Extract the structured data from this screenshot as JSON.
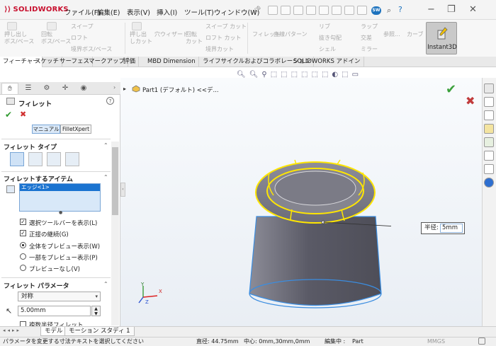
{
  "app": {
    "logo": "SOLIDWORKS"
  },
  "menu": [
    "ファイル(F)",
    "編集(E)",
    "表示(V)",
    "挿入(I)",
    "ツール(T)",
    "ウィンドウ(W)"
  ],
  "badge": {
    "label": "SW"
  },
  "ribbon": {
    "features_group": [
      {
        "label": "押し出し\nボス/ベース"
      },
      {
        "label": "回転\nボス/ベース"
      },
      {
        "label": "スイープ"
      },
      {
        "label": "ロフト"
      },
      {
        "label": "境界ボス/ベース"
      }
    ],
    "cut_group": [
      {
        "label": "押し出\nしカット"
      },
      {
        "label": "穴ウィザード"
      },
      {
        "label": "回転\nカット"
      },
      {
        "label": "スイープ カット"
      },
      {
        "label": "ロフト カット"
      },
      {
        "label": "境界カット"
      }
    ],
    "tools_group": [
      {
        "label": "フィレット"
      },
      {
        "label": "直線パターン"
      },
      {
        "label": "リブ"
      },
      {
        "label": "抜き勾配"
      },
      {
        "label": "シェル"
      },
      {
        "label": "ラップ"
      },
      {
        "label": "交差"
      },
      {
        "label": "ミラー"
      },
      {
        "label": "参照..."
      },
      {
        "label": "カーブ"
      }
    ],
    "instant3d_label": "Instant3D"
  },
  "command_tabs": [
    {
      "label": "フィーチャー",
      "active": true
    },
    {
      "label": "スケッチ"
    },
    {
      "label": "サーフェス"
    },
    {
      "label": "マークアップ"
    },
    {
      "label": "評価"
    },
    {
      "label": "MBD Dimension"
    },
    {
      "label": "ライフサイクルおよびコラボレーション"
    },
    {
      "label": "SOLIDWORKS アドイン"
    }
  ],
  "tree": {
    "breadcrumb": "Part1 (デフォルト) <<デ..."
  },
  "panel": {
    "title": "フィレット",
    "mode_buttons": [
      "マニュアル",
      "FilletXpert"
    ],
    "fillet_type_title": "フィレット タイプ",
    "items_title": "フィレットするアイテム",
    "edge_item": "エッジ<1>",
    "options": [
      {
        "label": "選択ツールバーを表示(L)",
        "checked": true
      },
      {
        "label": "正接の継続(G)",
        "checked": true
      }
    ],
    "preview_options": [
      {
        "label": "全体をプレビュー表示(W)",
        "selected": true
      },
      {
        "label": "一部をプレビュー表示(P)"
      },
      {
        "label": "プレビューなし(V)"
      }
    ],
    "params_title": "フィレット パラメータ",
    "symmetry_value": "対称",
    "radius_value": "5.00mm",
    "partial_label": "複数半径フィレット"
  },
  "graphics": {
    "callout_label": "半径:",
    "callout_value": "5mm",
    "axes": {
      "x": "X",
      "y": "Y",
      "z": "Z"
    }
  },
  "bottom_tabs": [
    {
      "label": "モデル",
      "active": true
    },
    {
      "label": "モーション スタディ 1"
    }
  ],
  "status": {
    "hint": "パラメータを変更する寸法テキストを選択してください",
    "diameter": "直径: 44.75mm",
    "center": "中心: 0mm,30mm,0mm",
    "editing": "編集中 :",
    "editing_target": "Part",
    "units": "MMGS"
  },
  "colors": {
    "accent_red": "#c8102e",
    "selection_yellow": "#ffe600",
    "edge_blue": "#3b8de0",
    "body_gray": "#6a6a76"
  }
}
